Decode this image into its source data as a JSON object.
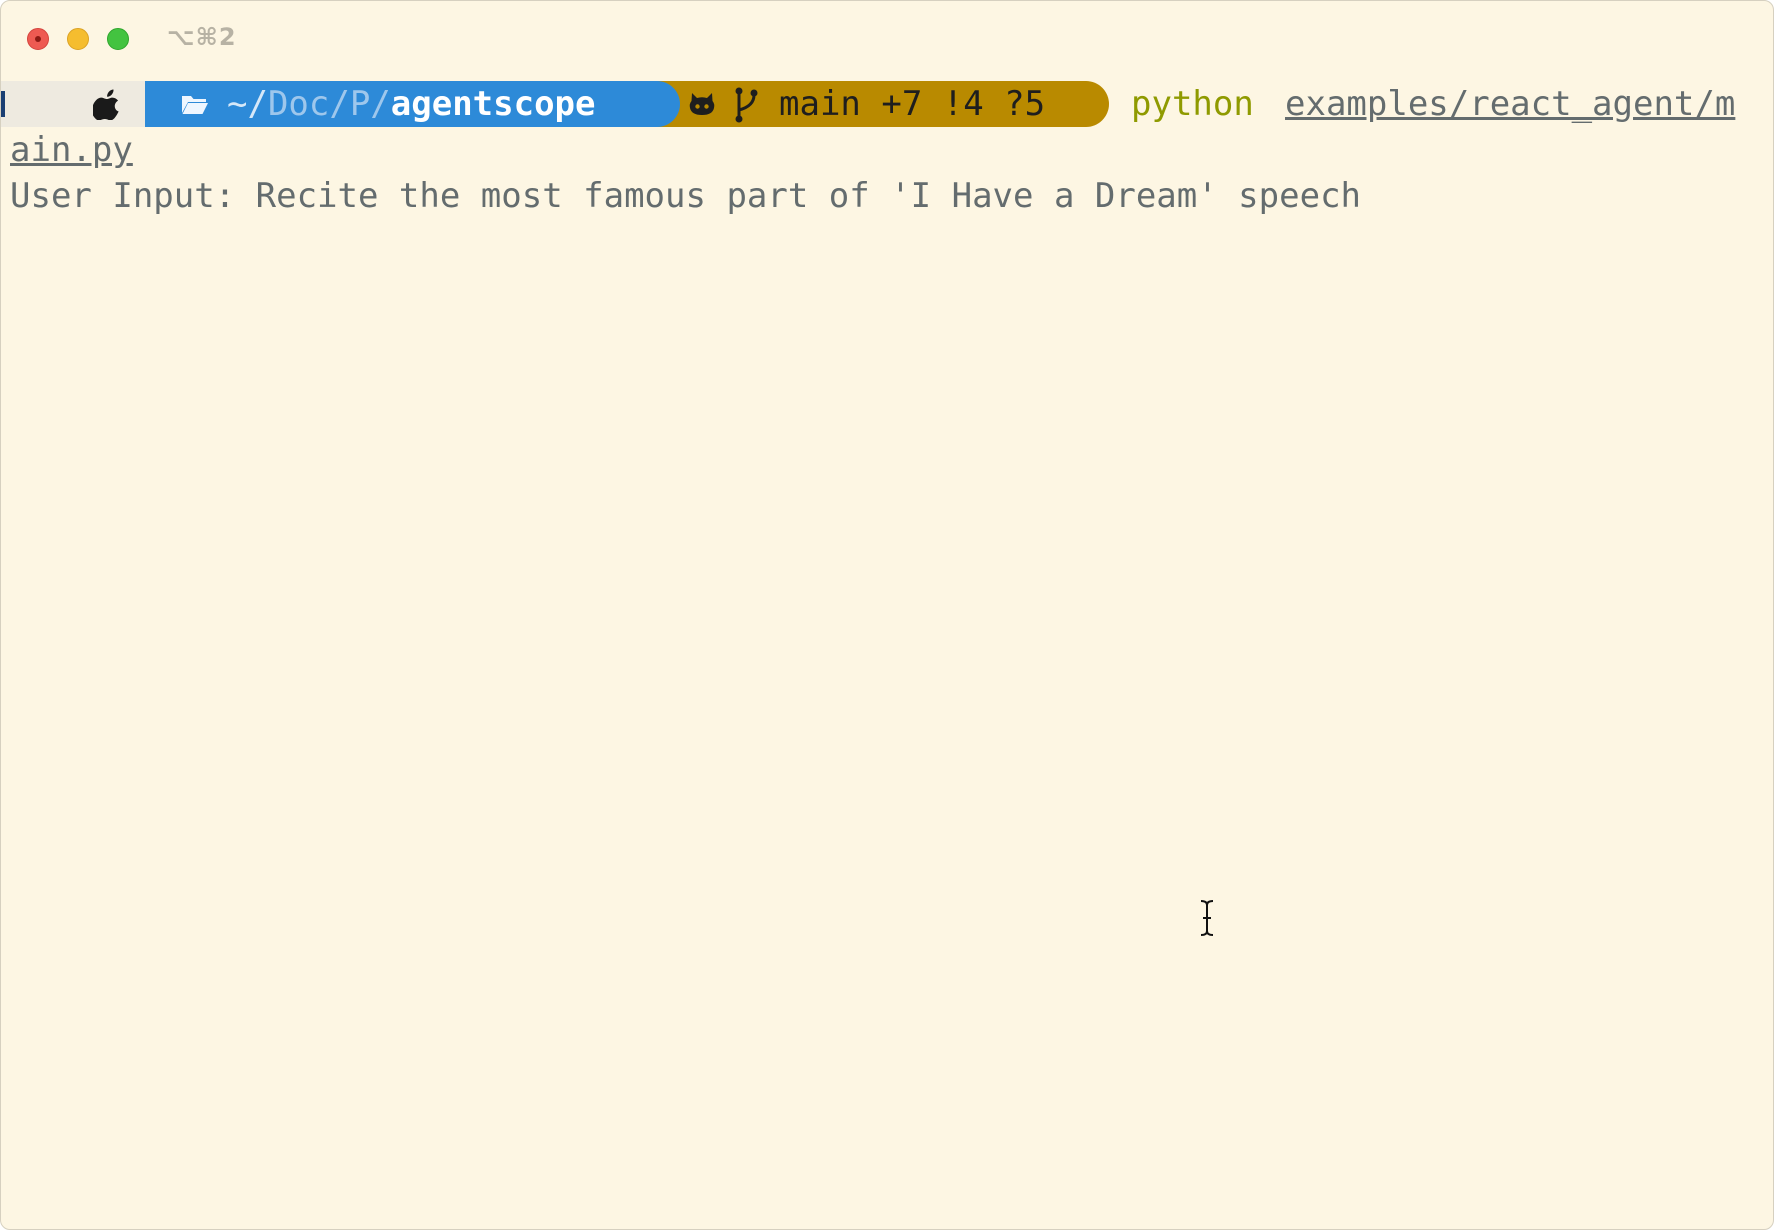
{
  "window": {
    "shortcut": "⌥⌘2",
    "colors": {
      "background": "#fdf6e3",
      "close": "#ee5a52",
      "minimize": "#f5bd2f",
      "maximize": "#43c340",
      "dir_segment": "#2d8ad8",
      "git_segment": "#b98a00",
      "python_cmd": "#8f9a00",
      "text": "#646c6e"
    }
  },
  "prompt": {
    "os_icon": "apple-icon",
    "dir": {
      "icon": "folder-icon",
      "prefix": "~/",
      "middle": "Doc/P/",
      "current": "agentscope"
    },
    "git": {
      "icons": [
        "github-icon",
        "branch-icon"
      ],
      "status": "main +7 !4 ?5"
    }
  },
  "command": {
    "program": "python",
    "arg_part1": "examples/react_agent/m",
    "arg_part2": "ain.py"
  },
  "output": {
    "user_input_line": "User Input: Recite the most famous part of 'I Have a Dream' speech"
  },
  "cursor": "ibeam-cursor-icon"
}
